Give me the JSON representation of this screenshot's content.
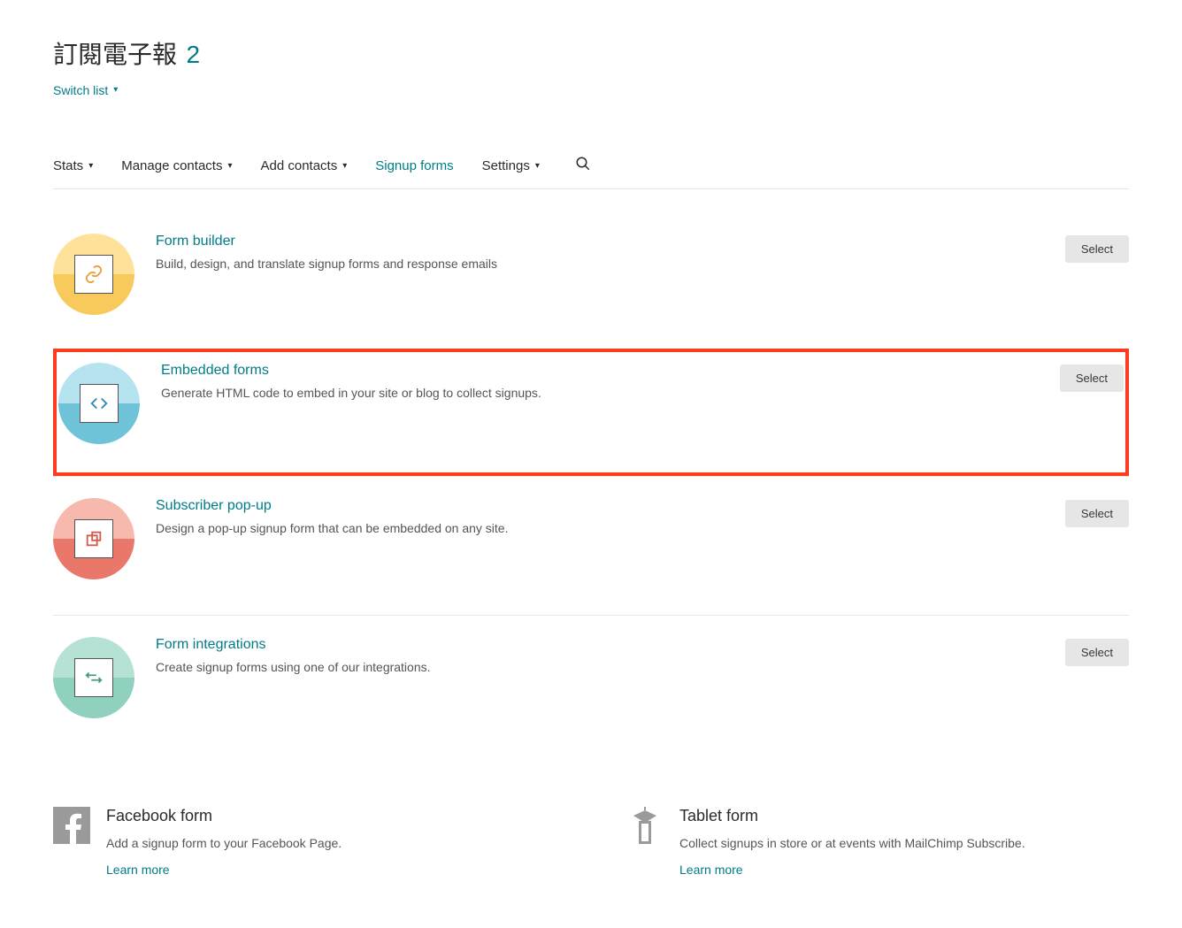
{
  "header": {
    "title": "訂閱電子報",
    "count": "2",
    "switch_list": "Switch list"
  },
  "tabs": {
    "stats": "Stats",
    "manage_contacts": "Manage contacts",
    "add_contacts": "Add contacts",
    "signup_forms": "Signup forms",
    "settings": "Settings"
  },
  "rows": [
    {
      "title": "Form builder",
      "desc": "Build, design, and translate signup forms and response emails",
      "select": "Select"
    },
    {
      "title": "Embedded forms",
      "desc": "Generate HTML code to embed in your site or blog to collect signups.",
      "select": "Select"
    },
    {
      "title": "Subscriber pop-up",
      "desc": "Design a pop-up signup form that can be embedded on any site.",
      "select": "Select"
    },
    {
      "title": "Form integrations",
      "desc": "Create signup forms using one of our integrations.",
      "select": "Select"
    }
  ],
  "bottom": {
    "facebook": {
      "title": "Facebook form",
      "desc": "Add a signup form to your Facebook Page.",
      "learn": "Learn more"
    },
    "tablet": {
      "title": "Tablet form",
      "desc": "Collect signups in store or at events with MailChimp Subscribe.",
      "learn": "Learn more"
    }
  }
}
